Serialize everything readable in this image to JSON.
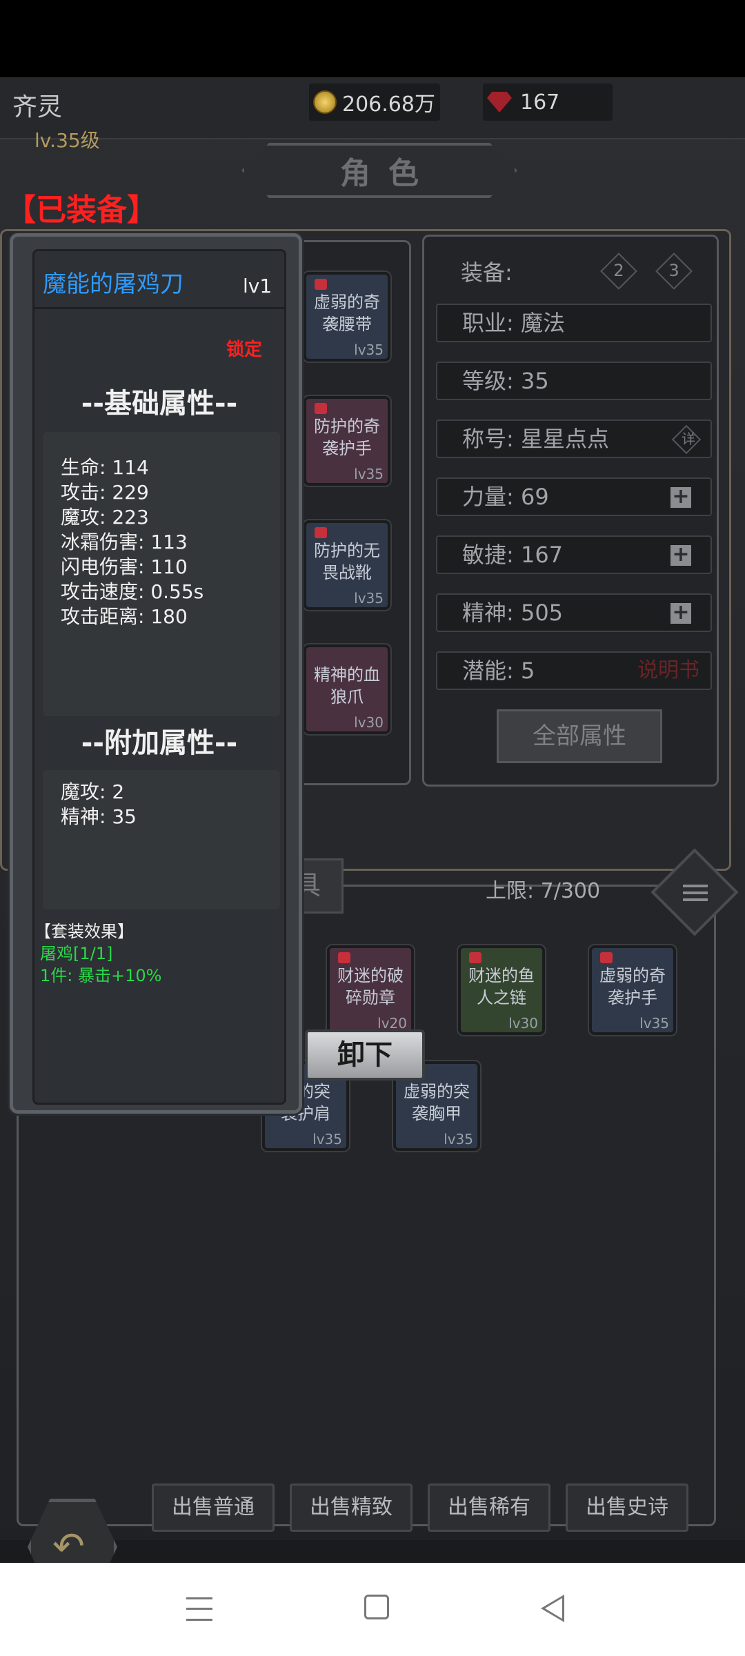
{
  "player": {
    "name": "齐灵",
    "level": "lv.35级"
  },
  "currency": {
    "gold": "206.68万",
    "gems": "167"
  },
  "header": {
    "title": "角色"
  },
  "equipped_label": "【已装备】",
  "equipment_slots": [
    {
      "name": "虚弱的奇袭腰带",
      "line1": "虚弱的奇",
      "line2": "袭腰带",
      "level": "lv35",
      "rarity": "blue",
      "locked": true
    },
    {
      "name": "防护的奇袭护手",
      "line1": "防护的奇",
      "line2": "袭护手",
      "level": "lv35",
      "rarity": "purple",
      "locked": true
    },
    {
      "name": "防护的无畏战靴",
      "line1": "防护的无",
      "line2": "畏战靴",
      "level": "lv35",
      "rarity": "blue",
      "locked": true
    },
    {
      "name": "精神的血狼爪",
      "line1": "精神的血",
      "line2": "狼爪",
      "level": "lv30",
      "rarity": "purple",
      "locked": false
    }
  ],
  "stats": {
    "equip_label": "装备:",
    "equip_set_badges": [
      "2",
      "3"
    ],
    "job": "职业: 魔法",
    "level": "等级: 35",
    "title": "称号: 星星点点",
    "title_badge": "详",
    "strength": "力量: 69",
    "agility": "敏捷: 167",
    "spirit": "精神: 505",
    "potential": "潜能: 5",
    "manual": "说明书",
    "all_attrs": "全部属性"
  },
  "inventory": {
    "tab_fragment": "具",
    "capacity": "上限: 7/300",
    "items": [
      {
        "line1": "财迷的破",
        "line2": "碎勋章",
        "level": "lv20",
        "rarity": "purple"
      },
      {
        "line1": "财迷的鱼",
        "line2": "人之链",
        "level": "lv30",
        "rarity": "green"
      },
      {
        "line1": "虚弱的奇",
        "line2": "袭护手",
        "level": "lv35",
        "rarity": "blue"
      },
      {
        "line1": "弱的突",
        "line2": "袭护肩",
        "level": "lv35",
        "rarity": "blue"
      },
      {
        "line1": "虚弱的突",
        "line2": "袭胸甲",
        "level": "lv35",
        "rarity": "blue"
      }
    ]
  },
  "popup": {
    "item_name": "魔能的屠鸡刀",
    "item_level": "lv1",
    "lock": "锁定",
    "base_header": "--基础属性--",
    "base_attrs": [
      "生命: 114",
      "攻击: 229",
      "魔攻: 223",
      "冰霜伤害: 113",
      "闪电伤害: 110",
      "攻击速度: 0.55s",
      "攻击距离: 180"
    ],
    "extra_header": "--附加属性--",
    "extra_attrs": [
      "魔攻: 2",
      "精神: 35"
    ],
    "set_header": "【套装效果】",
    "set_name": "屠鸡[1/1]",
    "set_bonus": "1件: 暴击+10%",
    "unequip": "卸下"
  },
  "bottom": {
    "sell_common": "出售普通",
    "sell_fine": "出售精致",
    "sell_rare": "出售稀有",
    "sell_epic": "出售史诗"
  },
  "colors": {
    "equipped_red": "#ff2020",
    "item_name_blue": "#2e9bff",
    "set_green": "#29d94a",
    "lock_red": "#ff2020"
  }
}
